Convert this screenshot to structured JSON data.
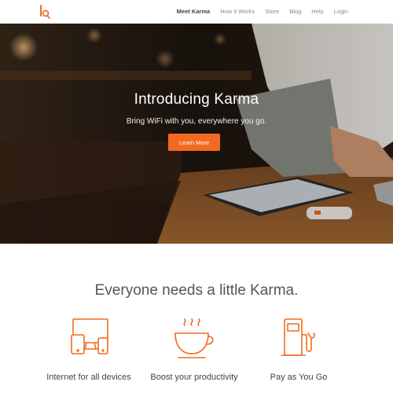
{
  "nav": {
    "logo": "karma-logo-icon",
    "links": [
      "Meet Karma",
      "How it Works",
      "Store",
      "Blog",
      "Help",
      "Login"
    ],
    "active_index": 0
  },
  "hero": {
    "title": "Introducing Karma",
    "subtitle": "Bring WiFi with you, everywhere you go.",
    "cta_label": "Learn More"
  },
  "features": {
    "tagline": "Everyone needs a little Karma.",
    "items": [
      {
        "label": "Internet for all devices",
        "icon": "devices-icon"
      },
      {
        "label": "Boost your productivity",
        "icon": "coffee-cup-icon"
      },
      {
        "label": "Pay as You Go",
        "icon": "fuel-pump-icon"
      }
    ]
  },
  "colors": {
    "accent": "#f26a21",
    "text": "#444444",
    "nav_muted": "#8a8a8a"
  }
}
